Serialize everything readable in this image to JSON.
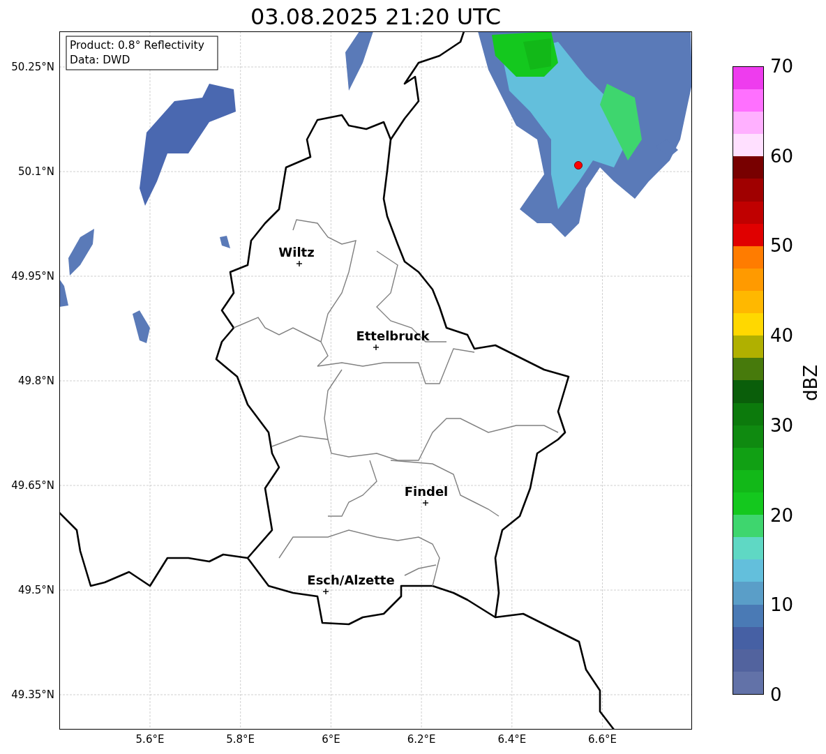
{
  "title": "03.08.2025 21:20 UTC",
  "legend": [
    "Product: 0.8° Reflectivity",
    "Data: DWD"
  ],
  "y_ticks": [
    "50.25°N",
    "50.1°N",
    "49.95°N",
    "49.8°N",
    "49.65°N",
    "49.5°N",
    "49.35°N"
  ],
  "x_ticks": [
    "5.6°E",
    "5.8°E",
    "6°E",
    "6.2°E",
    "6.4°E",
    "6.6°E"
  ],
  "cities": [
    {
      "name": "Wiltz"
    },
    {
      "name": "Ettelbruck"
    },
    {
      "name": "Findel"
    },
    {
      "name": "Esch/Alzette"
    }
  ],
  "colorbar": {
    "label": "dBZ",
    "ticks": [
      "70",
      "60",
      "50",
      "40",
      "30",
      "20",
      "10",
      "0"
    ],
    "bins": [
      {
        "color": "#6272a8"
      },
      {
        "color": "#52639e"
      },
      {
        "color": "#4660a4"
      },
      {
        "color": "#4a7ab5"
      },
      {
        "color": "#5a9ec8"
      },
      {
        "color": "#63bfdc"
      },
      {
        "color": "#5fd8c4"
      },
      {
        "color": "#3ed66e"
      },
      {
        "color": "#14c81e"
      },
      {
        "color": "#12b818"
      },
      {
        "color": "#11a014"
      },
      {
        "color": "#0f8a10"
      },
      {
        "color": "#0c7a0c"
      },
      {
        "color": "#0a5e0a"
      },
      {
        "color": "#477a0c"
      },
      {
        "color": "#b0b000"
      },
      {
        "color": "#ffd800"
      },
      {
        "color": "#ffb800"
      },
      {
        "color": "#ff9a00"
      },
      {
        "color": "#ff7c00"
      },
      {
        "color": "#e00000"
      },
      {
        "color": "#c00000"
      },
      {
        "color": "#a00000"
      },
      {
        "color": "#780000"
      },
      {
        "color": "#ffe0ff"
      },
      {
        "color": "#ffb0ff"
      },
      {
        "color": "#ff70ff"
      },
      {
        "color": "#ee3cee"
      }
    ]
  }
}
